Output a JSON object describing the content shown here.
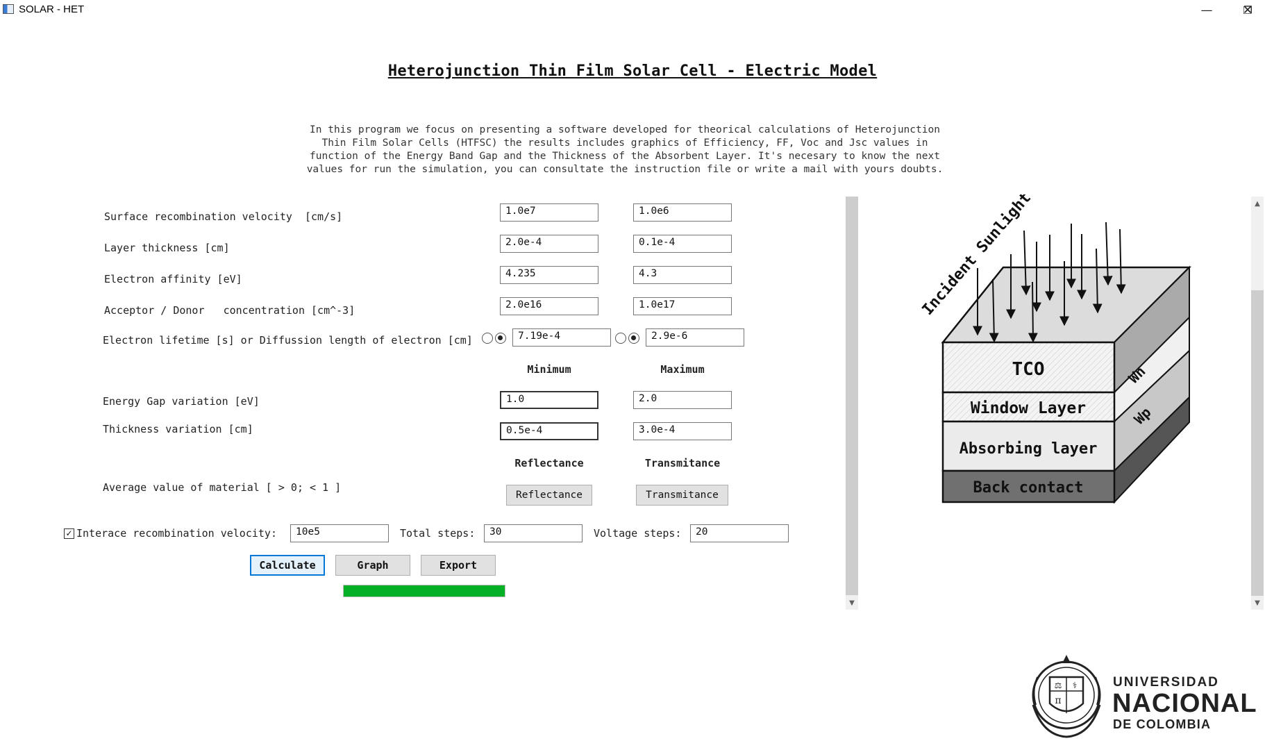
{
  "window": {
    "title": "SOLAR - HET",
    "minimize_glyph": "—",
    "restore_glyph": "❐",
    "close_glyph": "✕"
  },
  "header": {
    "title": "Heterojunction Thin Film Solar Cell - Electric Model",
    "intro": "In this program we focus on presenting a software developed for theorical calculations of Heterojunction\nThin Film Solar Cells (HTFSC) the results includes graphics of Efficiency, FF, Voc and Jsc values in\nfunction of the Energy Band Gap and the Thickness of the Absorbent Layer. It's necesary to know the next\nvalues for run the simulation, you can consultate the instruction file or write a mail with yours doubts."
  },
  "form": {
    "rows": [
      {
        "label": "Surface recombination velocity  [cm/s]",
        "value1": "1.0e7",
        "value2": "1.0e6"
      },
      {
        "label": "Layer thickness [cm]",
        "value1": "2.0e-4",
        "value2": "0.1e-4"
      },
      {
        "label": "Electron affinity [eV]",
        "value1": "4.235",
        "value2": "4.3"
      },
      {
        "label": "Acceptor / Donor   concentration [cm^-3]",
        "value1": "2.0e16",
        "value2": "1.0e17"
      }
    ],
    "lifetime": {
      "label": "Electron lifetime [s] or Diffussion length of electron [cm]",
      "value1": "7.19e-4",
      "value2": "2.9e-6",
      "selected1": "diffusion",
      "selected2": "diffusion"
    },
    "min_label": "Minimum",
    "max_label": "Maximum",
    "variation_rows": [
      {
        "label": "Energy Gap variation [eV]",
        "min": "1.0",
        "max": "2.0"
      },
      {
        "label": "Thickness variation [cm]",
        "min": "0.5e-4",
        "max": "3.0e-4"
      }
    ],
    "reflectance_label": "Reflectance",
    "transmitance_label": "Transmitance",
    "average_label": "Average value of material [ > 0; < 1 ]",
    "reflectance_button": "Reflectance",
    "transmitance_button": "Transmitance",
    "interface_check": {
      "label": "Interace recombination velocity:",
      "checked": true,
      "value": "10e5"
    },
    "total_steps": {
      "label": "Total steps:",
      "value": "30"
    },
    "voltage_steps": {
      "label": "Voltage steps:",
      "value": "20"
    }
  },
  "actions": {
    "calculate": "Calculate",
    "graph": "Graph",
    "export": "Export"
  },
  "progress": {
    "fraction": 1.0,
    "color": "#06b025"
  },
  "diagram": {
    "sunlight_label": "Incident Sunlight",
    "layers": [
      "TCO",
      "Window Layer",
      "Absorbing layer",
      "Back contact"
    ],
    "wn_label": "Wn",
    "wp_label": "Wp"
  },
  "logo": {
    "line1": "UNIVERSIDAD",
    "line2": "NACIONAL",
    "line3": "DE COLOMBIA"
  },
  "icons": {
    "checkbox": "✓",
    "scroll_up": "▲",
    "scroll_down": "▼"
  }
}
